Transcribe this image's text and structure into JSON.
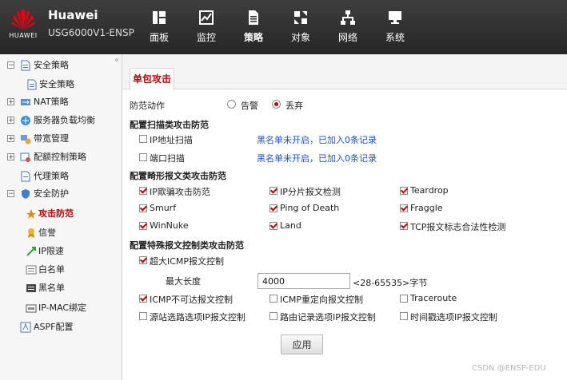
{
  "header": {
    "brand": "Huawei",
    "model": "USG6000V1-ENSP",
    "logo_text": "HUAWEI",
    "nav": [
      {
        "label": "面板",
        "icon": "dashboard-icon"
      },
      {
        "label": "监控",
        "icon": "monitor-icon"
      },
      {
        "label": "策略",
        "icon": "policy-icon"
      },
      {
        "label": "对象",
        "icon": "object-icon"
      },
      {
        "label": "网络",
        "icon": "network-icon"
      },
      {
        "label": "系统",
        "icon": "system-icon"
      }
    ],
    "active_nav": "策略"
  },
  "sidebar": {
    "collapse_glyph": "«",
    "items": [
      {
        "label": "安全策略",
        "toggle": "−",
        "icon": "security-policy-icon"
      },
      {
        "label": "安全策略",
        "icon": "security-policy-icon"
      },
      {
        "label": "NAT策略",
        "toggle": "+",
        "icon": "nat-icon"
      },
      {
        "label": "服务器负载均衡",
        "toggle": "+",
        "icon": "server-lb-icon"
      },
      {
        "label": "带宽管理",
        "toggle": "+",
        "icon": "bandwidth-icon"
      },
      {
        "label": "配额控制策略",
        "toggle": "+",
        "icon": "quota-icon"
      },
      {
        "label": "代理策略",
        "icon": "proxy-icon"
      },
      {
        "label": "安全防护",
        "toggle": "−",
        "icon": "shield-icon"
      },
      {
        "label": "攻击防范",
        "icon": "attack-defense-icon",
        "active": true
      },
      {
        "label": "信誉",
        "icon": "reputation-icon"
      },
      {
        "label": "IP限速",
        "icon": "ip-rate-limit-icon"
      },
      {
        "label": "白名单",
        "icon": "whitelist-icon"
      },
      {
        "label": "黑名单",
        "icon": "blacklist-icon"
      },
      {
        "label": "IP-MAC绑定",
        "icon": "ip-mac-binding-icon"
      },
      {
        "label": "ASPF配置",
        "icon": "aspf-icon"
      }
    ]
  },
  "main": {
    "tab": "单包攻击",
    "defense_action": {
      "label": "防范动作",
      "options": [
        "告警",
        "丢弃"
      ],
      "selected": "丢弃"
    },
    "scan_section": {
      "title": "配置扫描类攻击防范",
      "items": [
        {
          "label": "IP地址扫描",
          "checked": false,
          "link": "黑名单未开启，已加入0条记录"
        },
        {
          "label": "端口扫描",
          "checked": false,
          "link": "黑名单未开启，已加入0条记录"
        }
      ]
    },
    "malformed_section": {
      "title": "配置畸形报文类攻击防范",
      "items": [
        {
          "label": "IP欺骗攻击防范",
          "checked": true
        },
        {
          "label": "IP分片报文检测",
          "checked": true
        },
        {
          "label": "Teardrop",
          "checked": true
        },
        {
          "label": "Smurf",
          "checked": true
        },
        {
          "label": "Ping of Death",
          "checked": true
        },
        {
          "label": "Fraggle",
          "checked": true
        },
        {
          "label": "WinNuke",
          "checked": true
        },
        {
          "label": "Land",
          "checked": true
        },
        {
          "label": "TCP报文标志合法性检测",
          "checked": true
        }
      ]
    },
    "special_section": {
      "title": "配置特殊报文控制类攻击防范",
      "large_icmp": {
        "label": "超大ICMP报文控制",
        "checked": true
      },
      "max_length": {
        "label": "最大长度",
        "value": "4000",
        "hint": "<28-65535>字节"
      },
      "items": [
        {
          "label": "ICMP不可达报文控制",
          "checked": true
        },
        {
          "label": "ICMP重定向报文控制",
          "checked": false
        },
        {
          "label": "Traceroute",
          "checked": false
        },
        {
          "label": "源站选路选项IP报文控制",
          "checked": false
        },
        {
          "label": "路由记录选项IP报文控制",
          "checked": false
        },
        {
          "label": "时间戳选项IP报文控制",
          "checked": false
        }
      ]
    },
    "apply_button": "应用"
  },
  "watermark": "CSDN @ENSP-EDU",
  "colors": {
    "accent": "#c00000",
    "link": "#1d52c4",
    "topbar": "#2e2e2e"
  }
}
